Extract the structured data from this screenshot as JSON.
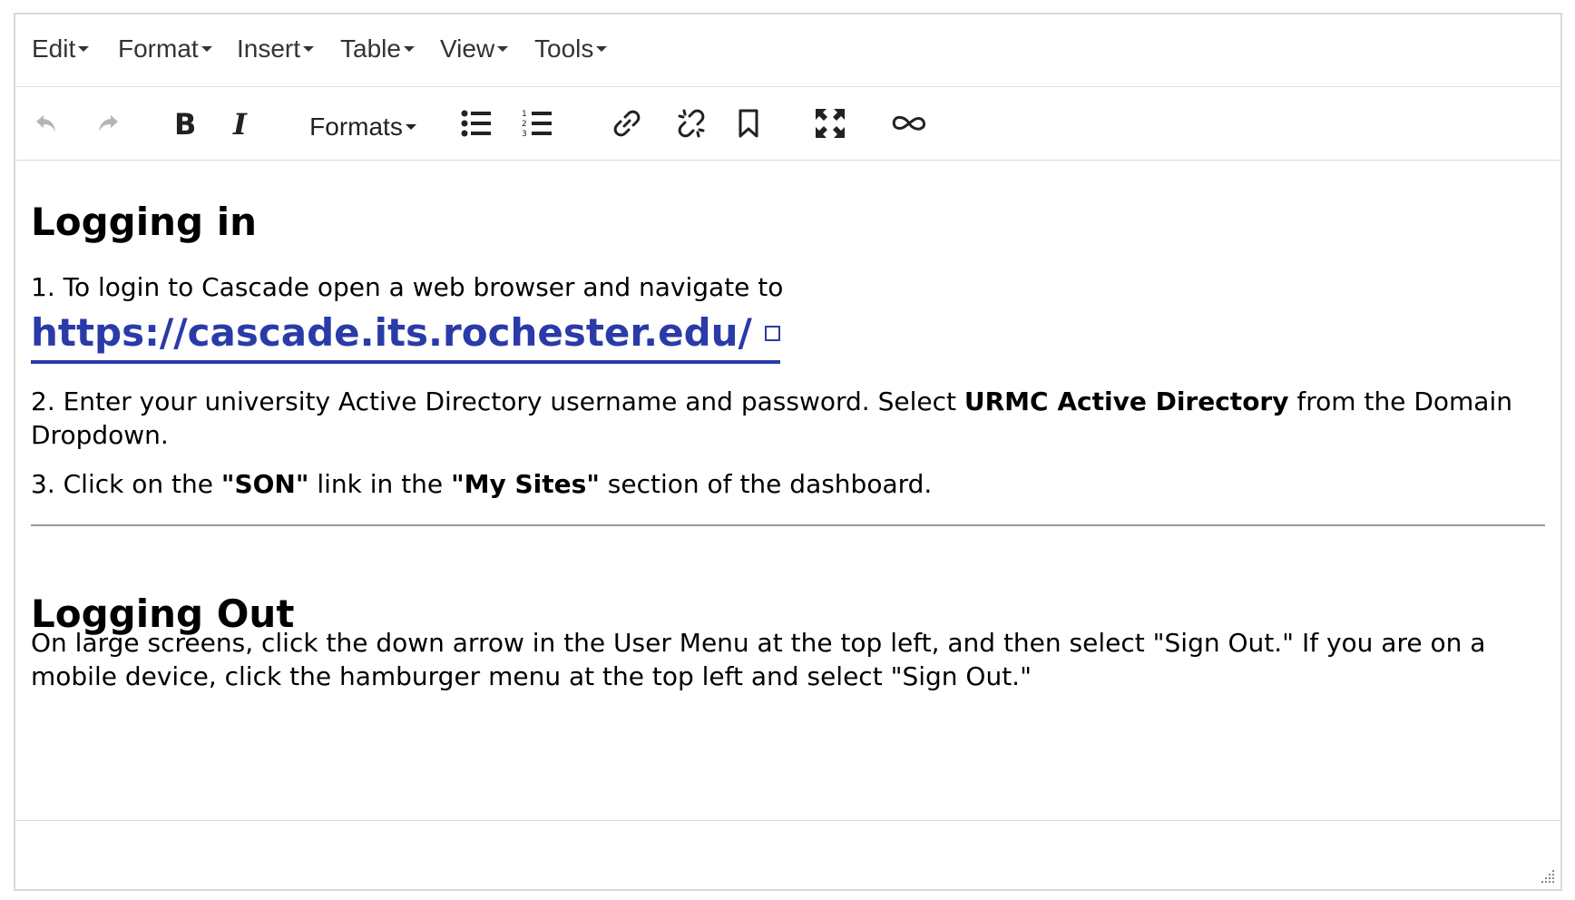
{
  "menubar": {
    "items": [
      {
        "label": "Edit"
      },
      {
        "label": "Format"
      },
      {
        "label": "Insert"
      },
      {
        "label": "Table"
      },
      {
        "label": "View"
      },
      {
        "label": "Tools"
      }
    ]
  },
  "toolbar": {
    "undo_icon": "undo-icon",
    "redo_icon": "redo-icon",
    "bold_icon": "bold-icon",
    "italic_icon": "italic-icon",
    "formats_label": "Formats",
    "bullet_list_icon": "bullet-list-icon",
    "numbered_list_icon": "numbered-list-icon",
    "link_icon": "link-icon",
    "unlink_icon": "unlink-icon",
    "bookmark_icon": "bookmark-icon",
    "fullscreen_icon": "fullscreen-icon",
    "infinity_icon": "infinity-icon"
  },
  "content": {
    "heading1": "Logging in",
    "step1_text": "1. To login to Cascade open a web browser and navigate to",
    "step1_link": "https://cascade.its.rochester.edu/",
    "step2_prefix": "2. Enter your university Active Directory username and password. Select ",
    "step2_bold": "URMC Active Directory",
    "step2_suffix": " from the Domain Dropdown.",
    "step3_prefix": "3. Click on the ",
    "step3_bold1": "\"SON\"",
    "step3_mid": " link in the ",
    "step3_bold2": "\"My Sites\"",
    "step3_suffix": " section of the dashboard.",
    "heading2": "Logging Out",
    "logout_text": "On large screens, click the down arrow in the User Menu at the top left, and then select \"Sign Out.\" If you are on a mobile device, click the hamburger menu at the top left and select \"Sign Out.\""
  },
  "colors": {
    "link": "#2a3ba8",
    "disabled_icon": "#b5b5b5",
    "border": "#d9d9d9"
  }
}
